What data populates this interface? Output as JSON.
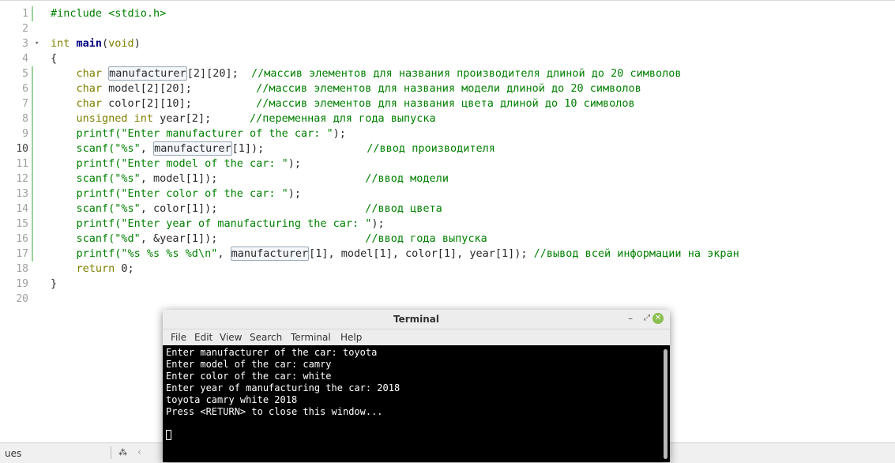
{
  "editor": {
    "line_numbers": [
      "1",
      "2",
      "3",
      "4",
      "5",
      "6",
      "7",
      "8",
      "9",
      "10",
      "11",
      "12",
      "13",
      "14",
      "15",
      "16",
      "17",
      "18",
      "19",
      "20"
    ],
    "fold_arrow": "▾",
    "lines": [
      {
        "segs": [
          {
            "t": "#include <stdio.h>",
            "c": "call"
          }
        ]
      },
      {
        "segs": []
      },
      {
        "segs": [
          {
            "t": "int ",
            "c": "kw"
          },
          {
            "t": "main",
            "c": "fn"
          },
          {
            "t": "(",
            "c": ""
          },
          {
            "t": "void",
            "c": "kw"
          },
          {
            "t": ")",
            "c": ""
          }
        ]
      },
      {
        "segs": [
          {
            "t": "{",
            "c": ""
          }
        ]
      },
      {
        "segs": [
          {
            "t": "    char ",
            "c": "kw"
          },
          {
            "t": "manufacturer",
            "c": "hl"
          },
          {
            "t": "[2][20];  ",
            "c": ""
          },
          {
            "t": "//массив элементов для названия производителя длиной до 20 символов",
            "c": "cm"
          }
        ]
      },
      {
        "segs": [
          {
            "t": "    char ",
            "c": "kw"
          },
          {
            "t": "model[2][20];          ",
            "c": ""
          },
          {
            "t": "//массив элементов для названия модели длиной до 20 символов",
            "c": "cm"
          }
        ]
      },
      {
        "segs": [
          {
            "t": "    char ",
            "c": "kw"
          },
          {
            "t": "color[2][10];          ",
            "c": ""
          },
          {
            "t": "//массив элементов для названия цвета длиной до 10 символов",
            "c": "cm"
          }
        ]
      },
      {
        "segs": [
          {
            "t": "    unsigned int ",
            "c": "kw"
          },
          {
            "t": "year[2];      ",
            "c": ""
          },
          {
            "t": "//переменная для года выпуска",
            "c": "cm"
          }
        ]
      },
      {
        "segs": [
          {
            "t": "    printf(",
            "c": "call"
          },
          {
            "t": "\"Enter manufacturer of the car: \"",
            "c": "str"
          },
          {
            "t": ");",
            "c": ""
          }
        ]
      },
      {
        "segs": [
          {
            "t": "    scanf(",
            "c": "call"
          },
          {
            "t": "\"%s\"",
            "c": "str"
          },
          {
            "t": ", ",
            "c": ""
          },
          {
            "t": "manufacturer",
            "c": "hl"
          },
          {
            "t": "[1]);                ",
            "c": ""
          },
          {
            "t": "//ввод производителя",
            "c": "cm"
          }
        ]
      },
      {
        "segs": [
          {
            "t": "    printf(",
            "c": "call"
          },
          {
            "t": "\"Enter model of the car: \"",
            "c": "str"
          },
          {
            "t": ");",
            "c": ""
          }
        ]
      },
      {
        "segs": [
          {
            "t": "    scanf(",
            "c": "call"
          },
          {
            "t": "\"%s\"",
            "c": "str"
          },
          {
            "t": ", model[1]);                       ",
            "c": ""
          },
          {
            "t": "//ввод модели",
            "c": "cm"
          }
        ]
      },
      {
        "segs": [
          {
            "t": "    printf(",
            "c": "call"
          },
          {
            "t": "\"Enter color of the car: \"",
            "c": "str"
          },
          {
            "t": ");",
            "c": ""
          }
        ]
      },
      {
        "segs": [
          {
            "t": "    scanf(",
            "c": "call"
          },
          {
            "t": "\"%s\"",
            "c": "str"
          },
          {
            "t": ", color[1]);                       ",
            "c": ""
          },
          {
            "t": "//ввод цвета",
            "c": "cm"
          }
        ]
      },
      {
        "segs": [
          {
            "t": "    printf(",
            "c": "call"
          },
          {
            "t": "\"Enter year of manufacturing the car: \"",
            "c": "str"
          },
          {
            "t": ");",
            "c": ""
          }
        ]
      },
      {
        "segs": [
          {
            "t": "    scanf(",
            "c": "call"
          },
          {
            "t": "\"%d\"",
            "c": "str"
          },
          {
            "t": ", &year[1]);                       ",
            "c": ""
          },
          {
            "t": "//ввод года выпуска",
            "c": "cm"
          }
        ]
      },
      {
        "segs": [
          {
            "t": "    printf(",
            "c": "call"
          },
          {
            "t": "\"%s %s %s %d\\n\"",
            "c": "str"
          },
          {
            "t": ", ",
            "c": ""
          },
          {
            "t": "manufacturer",
            "c": "hl"
          },
          {
            "t": "[1], model[1], color[1], year[1]); ",
            "c": ""
          },
          {
            "t": "//вывод всей информации на экран",
            "c": "cm"
          }
        ]
      },
      {
        "segs": [
          {
            "t": "    return ",
            "c": "kw"
          },
          {
            "t": "0;",
            "c": ""
          }
        ]
      },
      {
        "segs": [
          {
            "t": "}",
            "c": ""
          }
        ]
      },
      {
        "segs": []
      }
    ]
  },
  "statusbar": {
    "issues_label": "ues",
    "icon": "⁂",
    "prev_label": "‹"
  },
  "terminal": {
    "title": "Terminal",
    "minimize": "–",
    "maximize": "⤢",
    "close": "✕",
    "menu": [
      "File",
      "Edit",
      "View",
      "Search",
      "Terminal",
      "Help"
    ],
    "lines": [
      "Enter manufacturer of the car: toyota",
      "Enter model of the car: camry",
      "Enter color of the car: white",
      "Enter year of manufacturing the car: 2018",
      "toyota camry white 2018",
      "Press <RETURN> to close this window..."
    ]
  }
}
